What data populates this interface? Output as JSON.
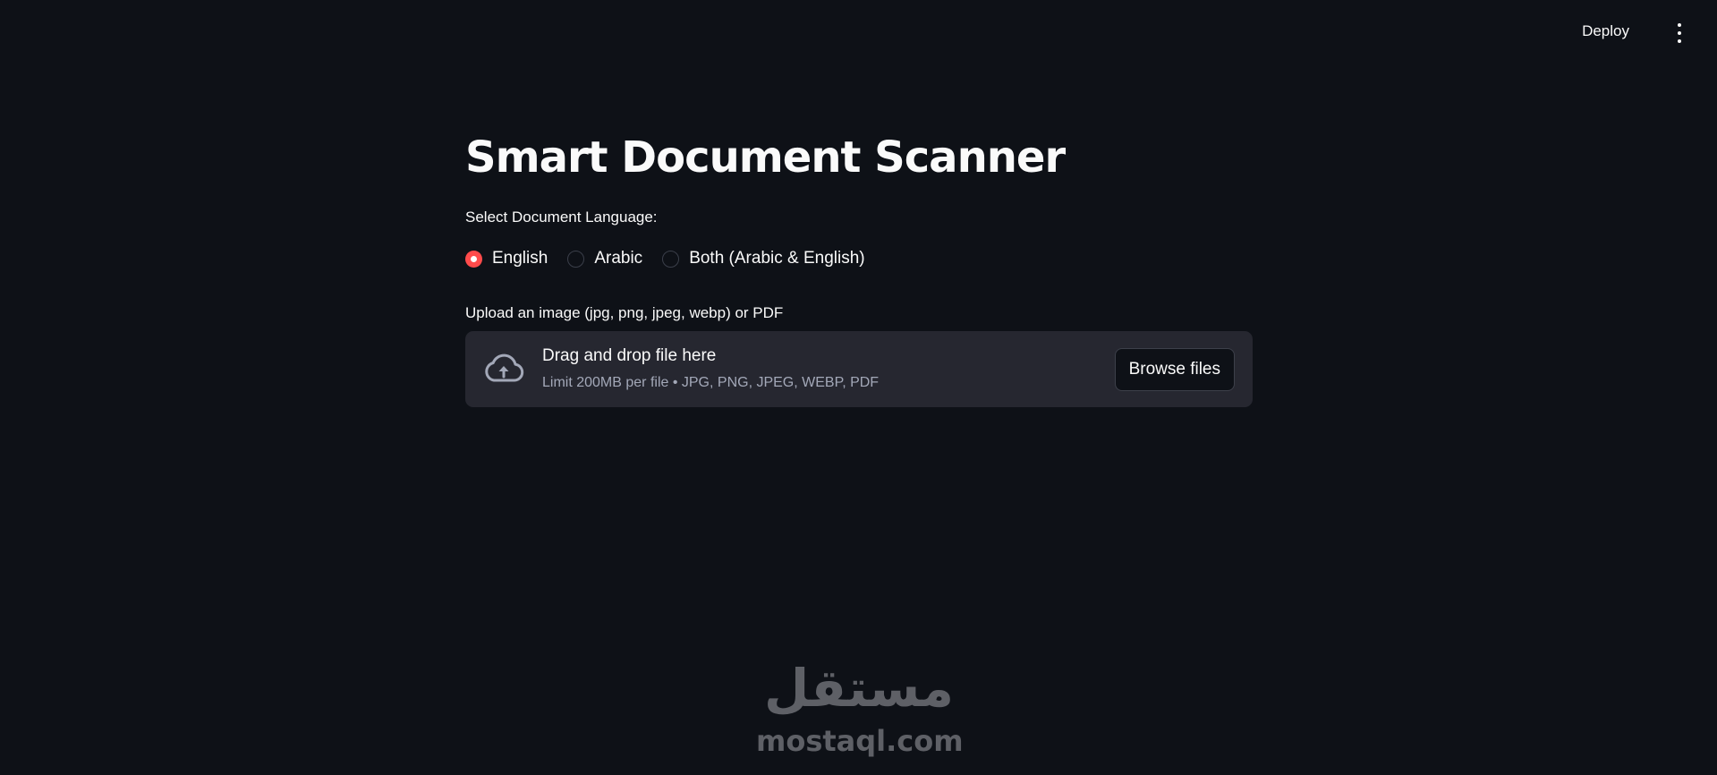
{
  "header": {
    "deploy_label": "Deploy",
    "menu_icon": "kebab-menu-icon"
  },
  "main": {
    "title": "Smart Document Scanner",
    "language": {
      "label": "Select Document Language:",
      "options": [
        "English",
        "Arabic",
        "Both (Arabic & English)"
      ],
      "selected": "English"
    },
    "uploader": {
      "label": "Upload an image (jpg, png, jpeg, webp) or PDF",
      "drop_text": "Drag and drop file here",
      "limit_text": "Limit 200MB per file • JPG, PNG, JPEG, WEBP, PDF",
      "button_label": "Browse files",
      "icon": "cloud-upload-icon"
    }
  },
  "watermark": {
    "arabic": "مستقل",
    "latin": "mostaql.com"
  },
  "colors": {
    "background": "#0e1117",
    "accent": "#ff4b4b",
    "dropzone": "#262730",
    "text": "#fafafa",
    "muted_text": "#a3a8b8"
  }
}
